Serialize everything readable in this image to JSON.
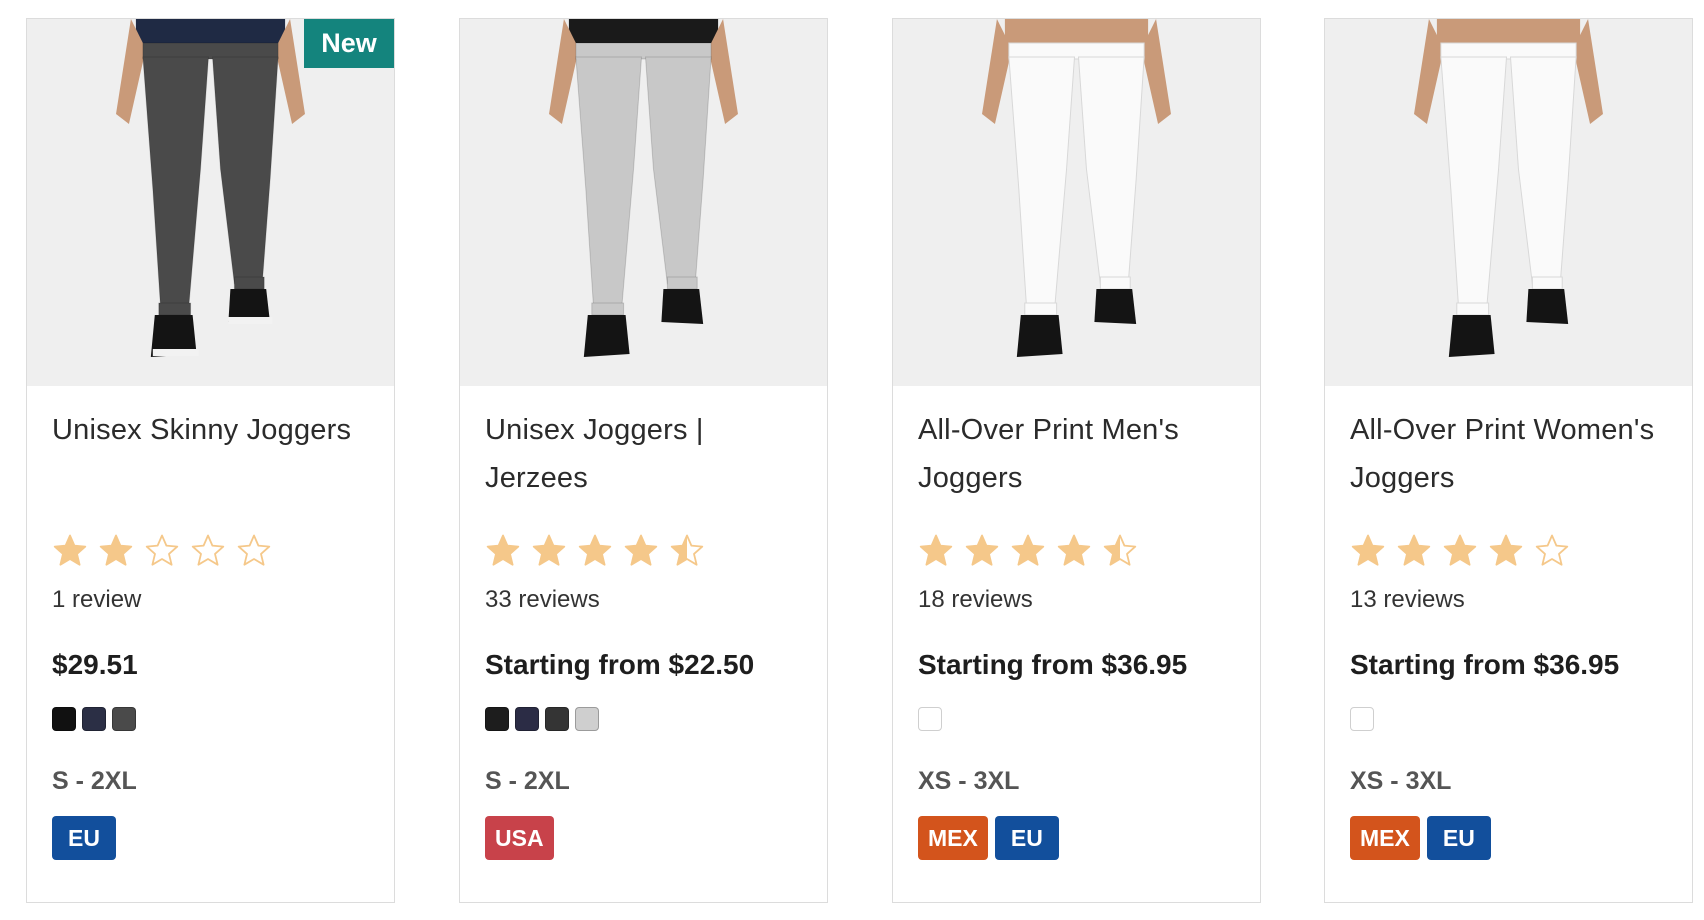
{
  "star_color": "#f5c88a",
  "products": [
    {
      "title": "Unisex Skinny Joggers",
      "badge": "New",
      "badge_color": "#14847d",
      "rating": 2,
      "reviews": "1 review",
      "price": "$29.51",
      "swatches": [
        "#111111",
        "#2b2f45",
        "#4a4a4a"
      ],
      "sizes": "S - 2XL",
      "regions": [
        {
          "label": "EU",
          "color": "#124f9c"
        }
      ],
      "pants_color": "#4a4a4a",
      "shirt_color": "#1f2a44"
    },
    {
      "title": "Unisex Joggers | Jerzees",
      "badge": "",
      "rating": 4.5,
      "reviews": "33 reviews",
      "price": "Starting from $22.50",
      "swatches": [
        "#1d1d1d",
        "#2b2c45",
        "#343434",
        "#cfcfcf"
      ],
      "sizes": "S - 2XL",
      "regions": [
        {
          "label": "USA",
          "color": "#c8424a"
        }
      ],
      "pants_color": "#c8c8c8",
      "shirt_color": "#1a1a1a"
    },
    {
      "title": "All-Over Print Men's Joggers",
      "badge": "",
      "rating": 4.5,
      "reviews": "18 reviews",
      "price": "Starting from $36.95",
      "swatches": [
        "#ffffff"
      ],
      "sizes": "XS - 3XL",
      "regions": [
        {
          "label": "MEX",
          "color": "#d3541c"
        },
        {
          "label": "EU",
          "color": "#124f9c"
        }
      ],
      "pants_color": "#fafafa",
      "shirt_color": ""
    },
    {
      "title": "All-Over Print Women's Joggers",
      "badge": "",
      "rating": 4,
      "reviews": "13 reviews",
      "price": "Starting from $36.95",
      "swatches": [
        "#ffffff"
      ],
      "sizes": "XS - 3XL",
      "regions": [
        {
          "label": "MEX",
          "color": "#d3541c"
        },
        {
          "label": "EU",
          "color": "#124f9c"
        }
      ],
      "pants_color": "#fafafa",
      "shirt_color": ""
    }
  ]
}
